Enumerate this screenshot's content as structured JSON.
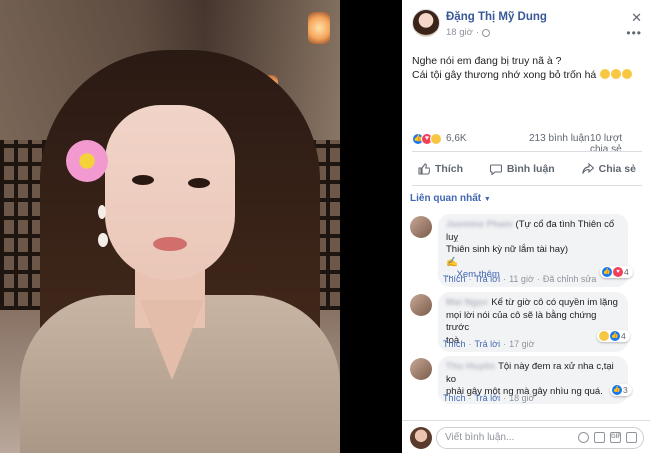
{
  "post": {
    "author": "Đặng Thị Mỹ Dung",
    "time": "18 giờ",
    "text_line1": "Nghe nói em đang bị truy nã à ?",
    "text_line2": "Cái tội gây thương nhớ xong bỏ trốn há",
    "reaction_count": "6,6K",
    "comment_count": "213 bình luận",
    "share_count": "10 lượt chia sẻ"
  },
  "actions": {
    "like": "Thích",
    "comment": "Bình luận",
    "share": "Chia sẻ"
  },
  "sort_label": "Liên quan nhất",
  "comments": [
    {
      "line1": "(Tự cổ đa tình Thiên cổ luỵ",
      "line2": "Thiên sinh kỳ nữ lắm tài hay)",
      "see_more": "... Xem thêm",
      "like": "Thích",
      "reply": "Trả lời",
      "time": "11 giờ",
      "edited": "Đã chỉnh sửa",
      "reactions": "4"
    },
    {
      "line1": "Kể từ giờ cô có quyền im lặng",
      "line2": "mọi lời nói của cô sẽ là bằng chứng trước",
      "line3": "toà",
      "like": "Thích",
      "reply": "Trả lời",
      "time": "17 giờ",
      "reactions": "4"
    },
    {
      "line1": "Tội này đem ra xử nha c,tại ko",
      "line2": "phải gây một ng mà gây nhìu ng quá.",
      "like": "Thích",
      "reply": "Trả lời",
      "time": "18 giờ",
      "reactions": "3"
    }
  ],
  "composer": {
    "placeholder": "Viết bình luận..."
  },
  "colors": {
    "link_blue": "#385898",
    "like_blue": "#1877f2",
    "love_red": "#f33e58",
    "haha_yellow": "#f7c744"
  }
}
